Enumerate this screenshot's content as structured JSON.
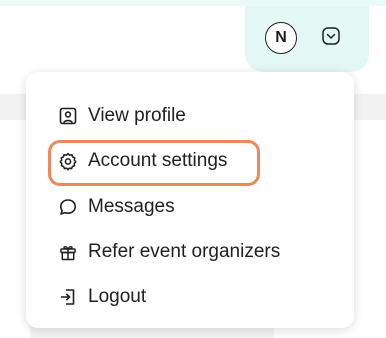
{
  "header": {
    "avatar_initial": "N"
  },
  "menu": {
    "items": [
      {
        "label": "View profile",
        "icon": "user-square-icon"
      },
      {
        "label": "Account settings",
        "icon": "gear-icon"
      },
      {
        "label": "Messages",
        "icon": "message-bubble-icon"
      },
      {
        "label": "Refer event organizers",
        "icon": "gift-icon"
      },
      {
        "label": "Logout",
        "icon": "logout-icon"
      }
    ],
    "highlighted_item": "Account settings"
  },
  "colors": {
    "header_pill": "#e3f7f4",
    "highlight_border": "#f0875a",
    "text": "#1f1f1f"
  }
}
